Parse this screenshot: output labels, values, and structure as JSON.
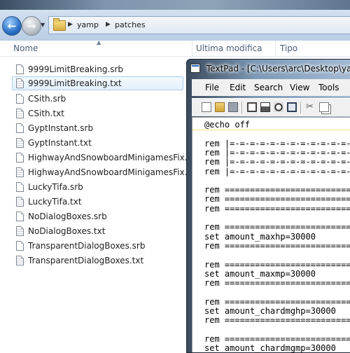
{
  "explorer": {
    "breadcrumb": [
      "yamp",
      "patches"
    ],
    "columns": {
      "name": "Nome",
      "modified": "Ultima modifica",
      "type": "Tipo"
    },
    "files": [
      {
        "name": "9999LimitBreaking.srb",
        "kind": "srb"
      },
      {
        "name": "9999LimitBreaking.txt",
        "kind": "txt",
        "selected": true
      },
      {
        "name": "CSith.srb",
        "kind": "srb"
      },
      {
        "name": "CSith.txt",
        "kind": "txt"
      },
      {
        "name": "GyptInstant.srb",
        "kind": "srb"
      },
      {
        "name": "GyptInstant.txt",
        "kind": "txt"
      },
      {
        "name": "HighwayAndSnowboardMinigamesFix.srb",
        "kind": "srb"
      },
      {
        "name": "HighwayAndSnowboardMinigamesFix.txt",
        "kind": "txt"
      },
      {
        "name": "LuckyTifa.srb",
        "kind": "srb"
      },
      {
        "name": "LuckyTifa.txt",
        "kind": "txt"
      },
      {
        "name": "NoDialogBoxes.srb",
        "kind": "srb"
      },
      {
        "name": "NoDialogBoxes.txt",
        "kind": "txt"
      },
      {
        "name": "TransparentDialogBoxes.srb",
        "kind": "srb"
      },
      {
        "name": "TransparentDialogBoxes.txt",
        "kind": "txt"
      }
    ]
  },
  "textpad": {
    "title": "TextPad - [C:\\Users\\arc\\Desktop\\yamp",
    "menu": [
      "File",
      "Edit",
      "Search",
      "View",
      "Tools"
    ],
    "lines": [
      "@echo off",
      "",
      "rem |=-=-=-=-=-=-=-=-=-=-=-=-=-=",
      "rem |=-=-=-=-=-=-=-=-=-=-=-=-=-=",
      "rem |=-=-=-=-=-=-=-=-=-=-=-=-=-=",
      "rem |=-=-=-=-=-=-=-=-=-=-=-=-=-=",
      "",
      "rem ============================",
      "rem ============================",
      "rem ============================",
      "",
      "rem ============================",
      "set amount_maxhp=30000",
      "rem ============================",
      "",
      "rem ============================",
      "set amount_maxmp=30000",
      "rem ============================",
      "",
      "rem ============================",
      "set amount_chardmghp=30000",
      "rem ============================",
      "",
      "rem ============================",
      "set amount_chardmgmp=30000"
    ]
  }
}
